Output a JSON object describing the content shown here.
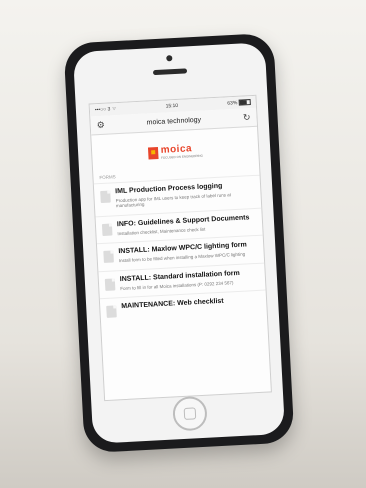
{
  "status_bar": {
    "carrier": "•••○○ 3 ⌔",
    "time": "15:10",
    "battery": "63%"
  },
  "nav": {
    "title": "moica technology",
    "left_icon": "gear-icon",
    "right_icon": "refresh-icon"
  },
  "logo": {
    "name": "moica",
    "tagline": "FOCUSED ON ENGINEERING"
  },
  "section_header": "Forms",
  "items": [
    {
      "title": "IML Production Process logging",
      "subtitle": "Production app for IML users to keep track of label runs at manufacturing"
    },
    {
      "title": "INFO: Guidelines & Support Documents",
      "subtitle": "Installation checklist, Maintenance check list"
    },
    {
      "title": "INSTALL: Maxlow WPC/C lighting form",
      "subtitle": "Install form to be filled when installing a Maxlow WPC/C lighting"
    },
    {
      "title": "INSTALL: Standard installation form",
      "subtitle": "Form to fill in for all Moica installations (P: 0292 234 567)"
    },
    {
      "title": "MAINTENANCE: Web checklist",
      "subtitle": ""
    }
  ],
  "colors": {
    "brand": "#e8452b",
    "accent": "#f7b500"
  }
}
